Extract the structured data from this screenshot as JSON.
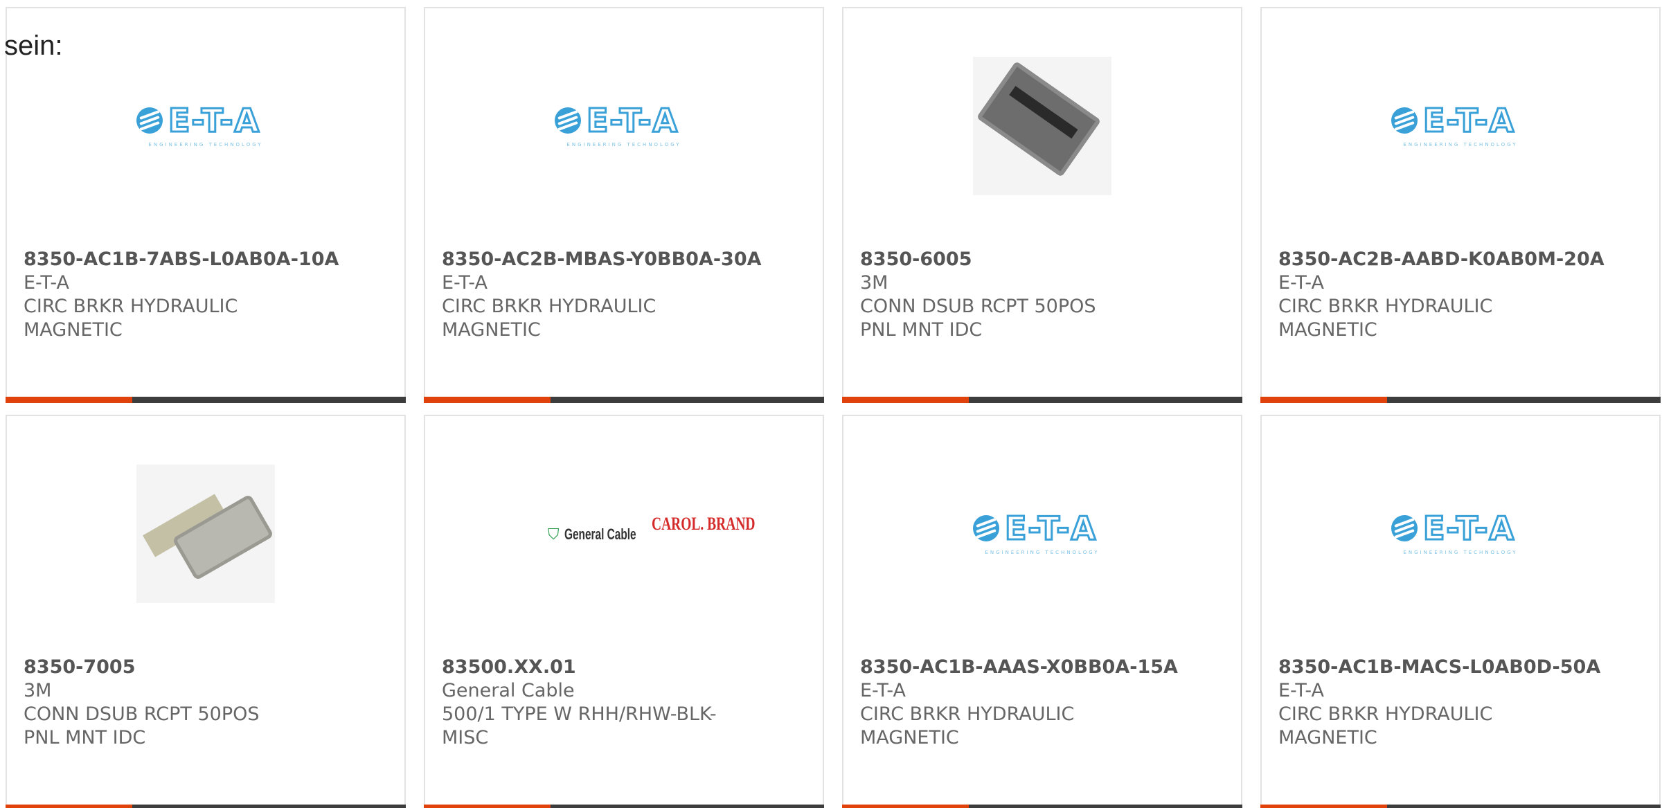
{
  "prefix_text": "sein:",
  "products": [
    {
      "part": "8350-AC1B-7ABS-L0AB0A-10A",
      "maker": "E-T-A",
      "desc": "CIRC BRKR HYDRAULIC MAGNETIC",
      "image": "eta-logo"
    },
    {
      "part": "8350-AC2B-MBAS-Y0BB0A-30A",
      "maker": "E-T-A",
      "desc": "CIRC BRKR HYDRAULIC MAGNETIC",
      "image": "eta-logo"
    },
    {
      "part": "8350-6005",
      "maker": "3M",
      "desc": "CONN DSUB RCPT 50POS PNL MNT IDC",
      "image": "connector-photo"
    },
    {
      "part": "8350-AC2B-AABD-K0AB0M-20A",
      "maker": "E-T-A",
      "desc": "CIRC BRKR HYDRAULIC MAGNETIC",
      "image": "eta-logo"
    },
    {
      "part": "8350-7005",
      "maker": "3M",
      "desc": "CONN DSUB RCPT 50POS PNL MNT IDC",
      "image": "connector-photo"
    },
    {
      "part": "83500.XX.01",
      "maker": "General Cable",
      "desc": "500/1 TYPE W RHH/RHW-BLK-MISC",
      "image": "general-cable-logo"
    },
    {
      "part": "8350-AC1B-AAAS-X0BB0A-15A",
      "maker": "E-T-A",
      "desc": "CIRC BRKR HYDRAULIC MAGNETIC",
      "image": "eta-logo"
    },
    {
      "part": "8350-AC1B-MACS-L0AB0D-50A",
      "maker": "E-T-A",
      "desc": "CIRC BRKR HYDRAULIC MAGNETIC",
      "image": "eta-logo"
    }
  ],
  "logos": {
    "eta_letters": "E-T-A",
    "eta_tagline": "ENGINEERING TECHNOLOGY",
    "gc_name": "General Cable",
    "gc_brand": "CAROL. BRAND"
  },
  "colors": {
    "accent": "#e0420c",
    "bar": "#3d3d3d",
    "eta_blue": "#3aa0d8"
  }
}
